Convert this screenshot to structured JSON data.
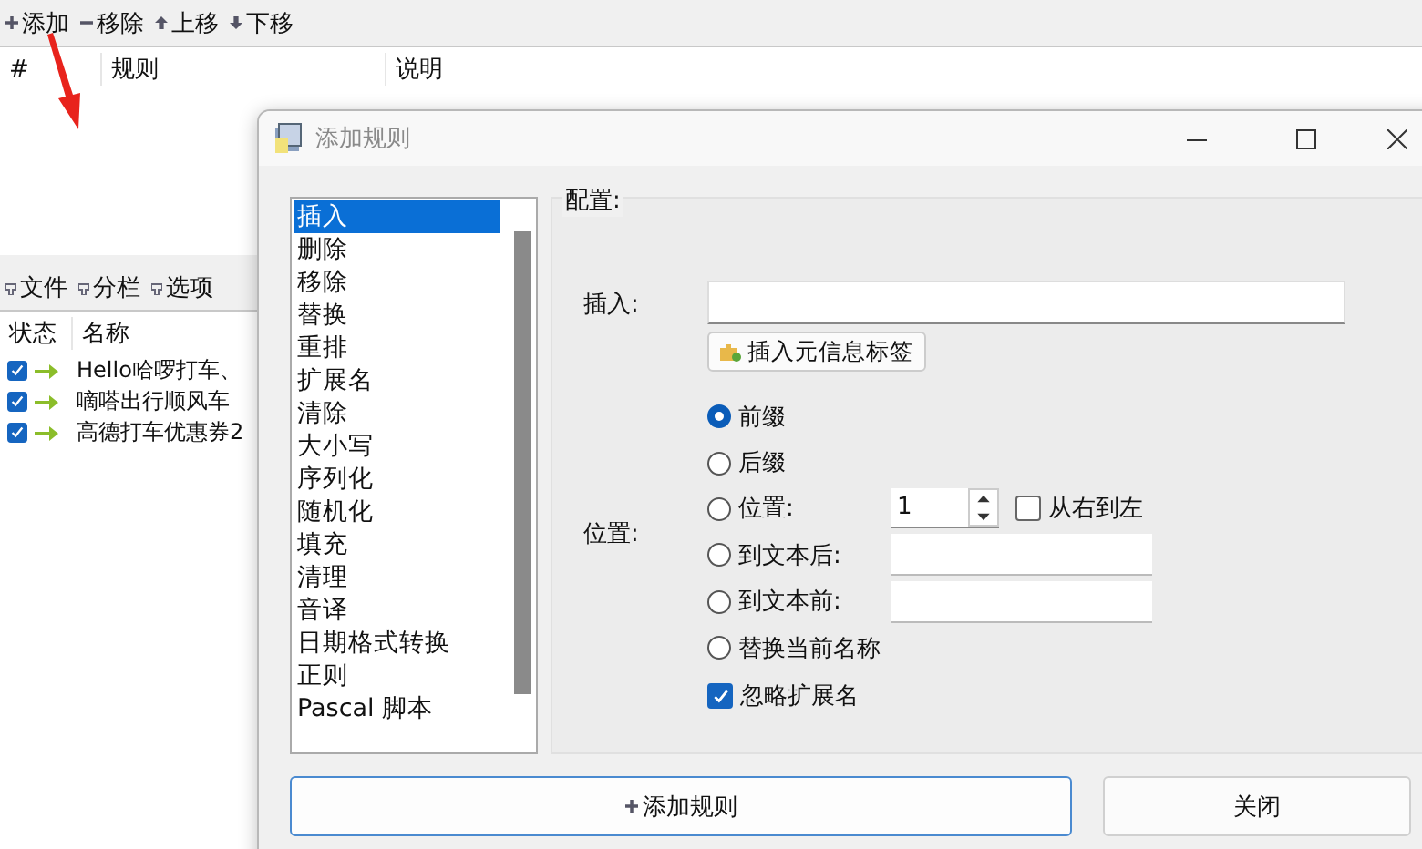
{
  "main": {
    "toolbar": [
      {
        "kind": "plus",
        "label": "添加"
      },
      {
        "kind": "minus",
        "label": "移除"
      },
      {
        "kind": "up",
        "label": "上移"
      },
      {
        "kind": "down",
        "label": "下移"
      }
    ],
    "rules_table": {
      "columns": [
        "#",
        "规则",
        "说明"
      ]
    },
    "files_toolbar": [
      {
        "label": "文件"
      },
      {
        "label": "分栏"
      },
      {
        "label": "选项"
      }
    ],
    "files_table": {
      "columns": [
        "状态",
        "名称"
      ],
      "rows": [
        {
          "checked": true,
          "name": "Hello哈啰打车、"
        },
        {
          "checked": true,
          "name": "嘀嗒出行顺风车"
        },
        {
          "checked": true,
          "name": "高德打车优惠券2"
        }
      ]
    }
  },
  "dialog": {
    "title": "添加规则",
    "rules": [
      {
        "label": "插入",
        "selected": true
      },
      {
        "label": "删除",
        "selected": false
      },
      {
        "label": "移除",
        "selected": false
      },
      {
        "label": "替换",
        "selected": false
      },
      {
        "label": "重排",
        "selected": false
      },
      {
        "label": "扩展名",
        "selected": false
      },
      {
        "label": "清除",
        "selected": false
      },
      {
        "label": "大小写",
        "selected": false
      },
      {
        "label": "序列化",
        "selected": false
      },
      {
        "label": "随机化",
        "selected": false
      },
      {
        "label": "填充",
        "selected": false
      },
      {
        "label": "清理",
        "selected": false
      },
      {
        "label": "音译",
        "selected": false
      },
      {
        "label": "日期格式转换",
        "selected": false
      },
      {
        "label": "正则",
        "selected": false
      },
      {
        "label": "Pascal 脚本",
        "selected": false
      }
    ],
    "config": {
      "title": "配置:",
      "insert_label": "插入:",
      "meta_button": "插入元信息标签",
      "position_label": "位置:",
      "options": [
        {
          "kind": "plain",
          "label": "前缀",
          "selected": true
        },
        {
          "kind": "plain",
          "label": "后缀",
          "selected": false
        },
        {
          "kind": "spin",
          "label": "位置:",
          "selected": false,
          "value": "1",
          "checkbox": {
            "label": "从右到左",
            "checked": false
          }
        },
        {
          "kind": "field",
          "label": "到文本后:",
          "selected": false
        },
        {
          "kind": "field",
          "label": "到文本前:",
          "selected": false
        },
        {
          "kind": "plain",
          "label": "替换当前名称",
          "selected": false
        }
      ],
      "ignore_extension": {
        "label": "忽略扩展名",
        "checked": true
      }
    },
    "buttons": [
      {
        "kind": "primary",
        "label": "添加规则"
      },
      {
        "kind": "normal",
        "label": "关闭"
      }
    ]
  }
}
